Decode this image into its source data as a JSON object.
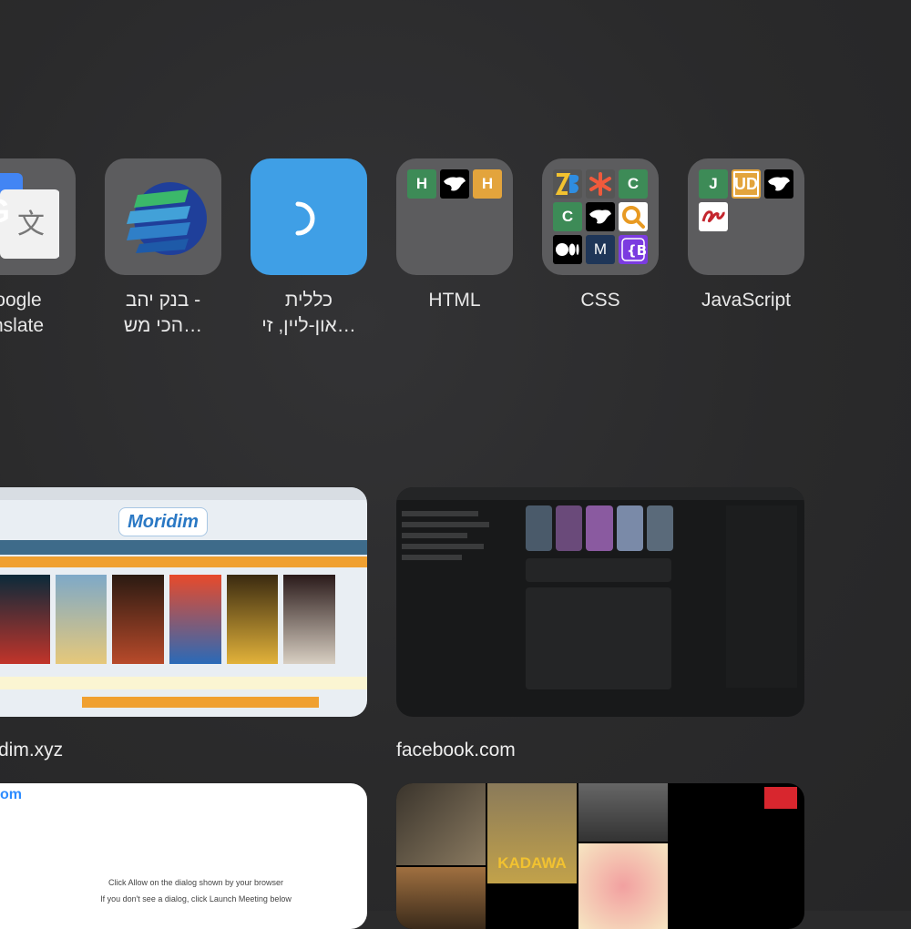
{
  "bookmarks": [
    {
      "label": "Google\nTranslate",
      "visible_label": "oogle\nnslate",
      "icon": "google-translate-icon"
    },
    {
      "label": "בנק יהב -\nהכי מש…",
      "icon": "bank-yahav-globe-icon"
    },
    {
      "label": "כללית\nאון-ליין, זי…",
      "icon": "clalit-logo-icon"
    },
    {
      "label": "HTML",
      "icon": "folder-icon",
      "items": [
        "H",
        "H"
      ]
    },
    {
      "label": "CSS",
      "icon": "folder-icon",
      "items": [
        "C",
        "C",
        "M"
      ]
    },
    {
      "label": "JavaScript",
      "icon": "folder-icon",
      "items": [
        "J",
        "UD"
      ]
    }
  ],
  "frequent": [
    {
      "label": "dim.xyz",
      "site_text": "Moridim"
    },
    {
      "label": "facebook.com"
    }
  ],
  "bottom": {
    "left_text_1": "Click Allow on the dialog shown by your browser",
    "left_text_2": "If you don't see a dialog, click Launch Meeting below",
    "movie_title": "KADAWA"
  }
}
